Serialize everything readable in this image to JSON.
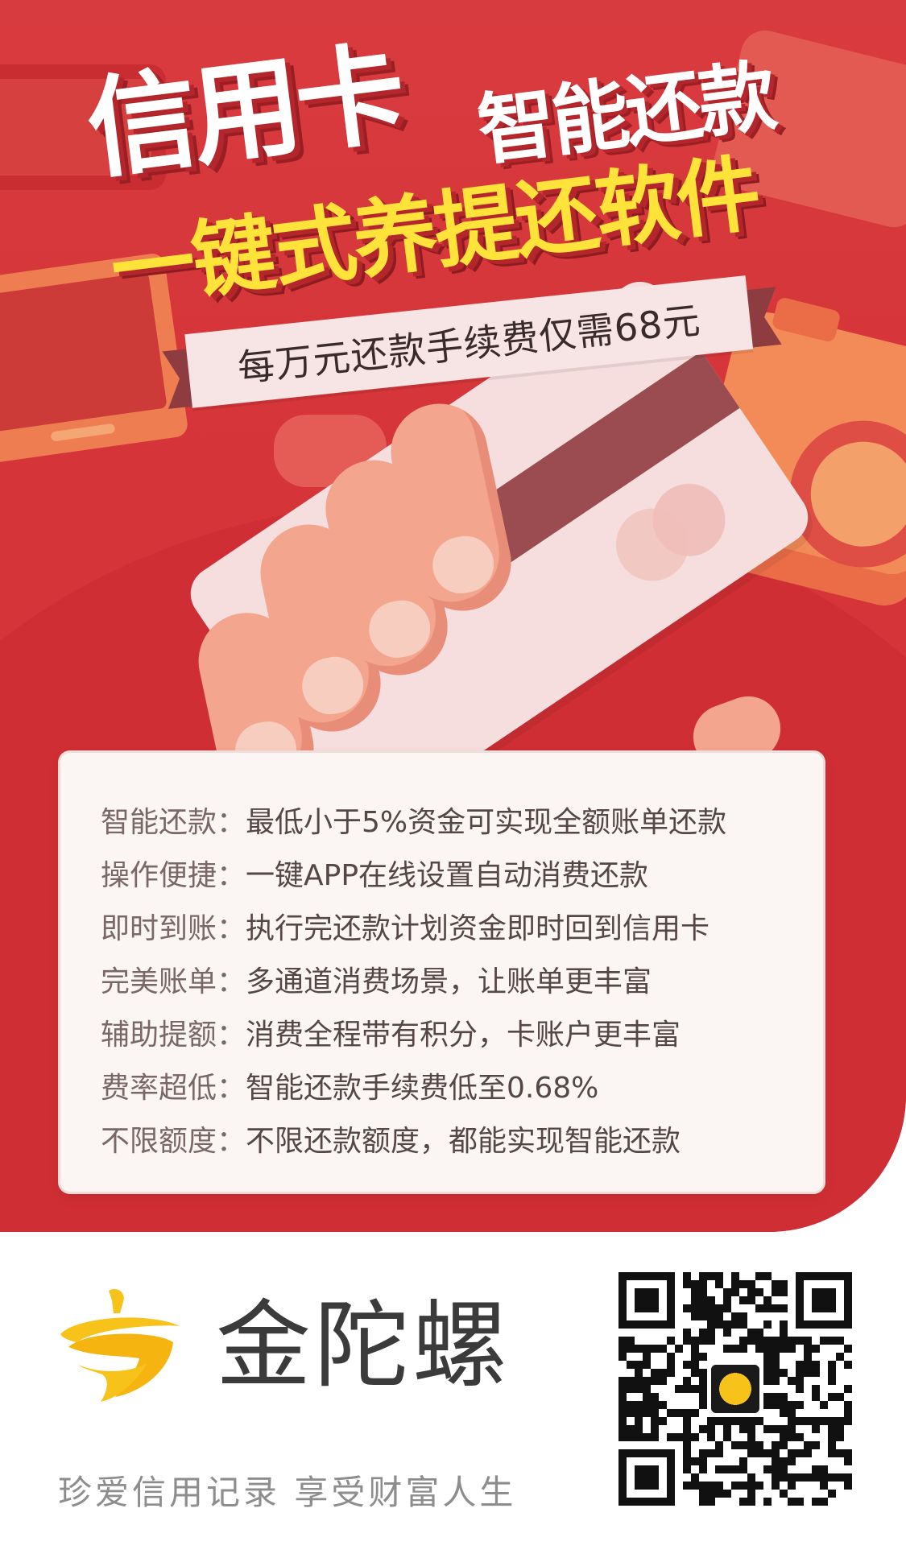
{
  "headline": {
    "line1_big": "信用卡",
    "line1_small": "智能还款",
    "line2": "一键式养提还软件",
    "ribbon": "每万元还款手续费仅需68元"
  },
  "features": [
    {
      "label": "智能还款：",
      "desc": "最低小于5%资金可实现全额账单还款"
    },
    {
      "label": "操作便捷：",
      "desc": "一键APP在线设置自动消费还款"
    },
    {
      "label": "即时到账：",
      "desc": "执行完还款计划资金即时回到信用卡"
    },
    {
      "label": "完美账单：",
      "desc": "多通道消费场景，让账单更丰富"
    },
    {
      "label": "辅助提额：",
      "desc": "消费全程带有积分，卡账户更丰富"
    },
    {
      "label": "费率超低：",
      "desc": "智能还款手续费低至0.68%"
    },
    {
      "label": "不限额度：",
      "desc": "不限还款额度，都能实现智能还款"
    }
  ],
  "brand": {
    "name": "金陀螺",
    "slogan": "珍爱信用记录  享受财富人生",
    "logo_icon": "spinning-top-icon"
  },
  "colors": {
    "hero_red": "#d53438",
    "headline_yellow": "#ffe23a",
    "brand_yellow": "#f7c21a"
  }
}
